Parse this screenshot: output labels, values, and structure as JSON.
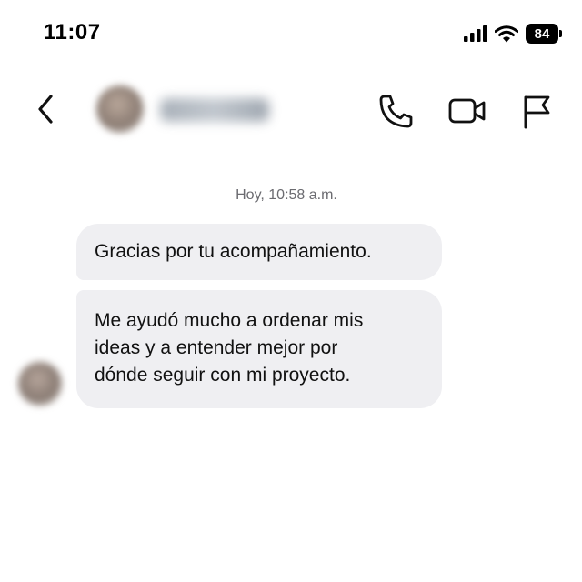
{
  "status_bar": {
    "time": "11:07",
    "battery": "84",
    "icons": [
      "signal-icon",
      "wifi-icon",
      "battery-icon"
    ]
  },
  "header": {
    "icons": [
      "chevron-left-icon",
      "phone-icon",
      "video-camera-icon",
      "flag-icon"
    ]
  },
  "conversation": {
    "timestamp": "Hoy, 10:58 a.m.",
    "messages": [
      {
        "lines": [
          "Gracias por tu acompañamiento."
        ]
      },
      {
        "lines": [
          "Me ayudó mucho a ordenar mis",
          "ideas y a entender mejor por",
          "dónde seguir con mi proyecto."
        ]
      }
    ]
  },
  "colors": {
    "bubble_background": "#efeff2",
    "timestamp_text": "#6b6b70",
    "icon_stroke": "#111111"
  }
}
